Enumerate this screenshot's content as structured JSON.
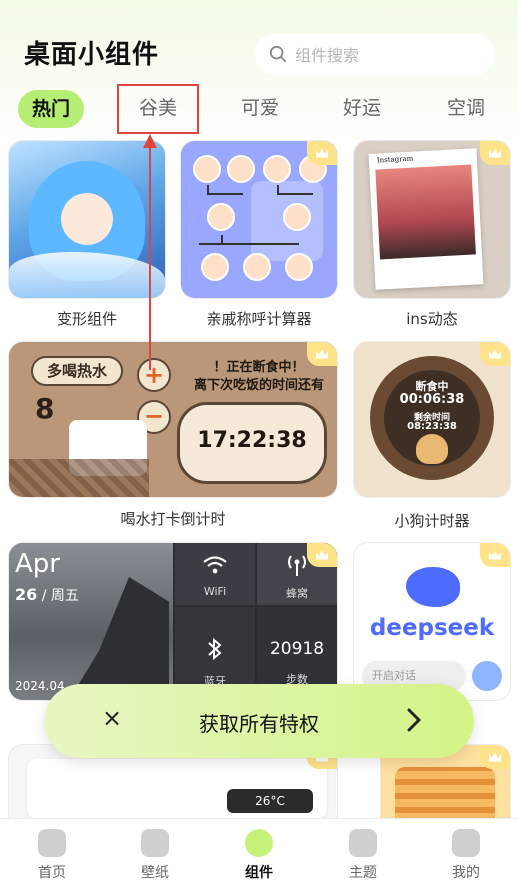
{
  "header": {
    "title": "桌面小组件"
  },
  "search": {
    "placeholder": "组件搜索"
  },
  "tabs": [
    {
      "label": "热门",
      "active": true
    },
    {
      "label": "谷美",
      "active": false
    },
    {
      "label": "可爱",
      "active": false
    },
    {
      "label": "好运",
      "active": false
    },
    {
      "label": "空调",
      "active": false
    }
  ],
  "cards": {
    "transform": {
      "label": "变形组件",
      "premium": false
    },
    "relatives": {
      "label": "亲戚称呼计算器",
      "premium": true
    },
    "ins": {
      "label": "ins动态",
      "premium": true,
      "brand": "Instagram"
    },
    "water": {
      "label": "喝水打卡倒计时",
      "premium": true,
      "badge": "多喝热水",
      "count": "8",
      "plus": "+",
      "minus": "−",
      "line1": "！正在断食中！",
      "line2": "离下次吃饭的时间还有",
      "time": "17:22:38"
    },
    "dog": {
      "label": "小狗计时器",
      "premium": true,
      "status": "断食中",
      "time1": "00:06:38",
      "remain_label": "剩余时间",
      "time2": "08:23:38"
    },
    "phone": {
      "month": "Apr",
      "day": "26",
      "weekday": "/ 周五",
      "year": "2024.04",
      "wifi": "WiFi",
      "cellular": "蜂窝",
      "bluetooth": "蓝牙",
      "steps": "20918",
      "steps_label": "步数"
    },
    "deepseek": {
      "brand": "deepseek",
      "input_placeholder": "开启对话",
      "premium": true
    },
    "ac": {
      "temp": "26°C"
    }
  },
  "promo": {
    "text": "获取所有特权",
    "close": "×"
  },
  "nav": [
    {
      "label": "首页",
      "icon": "home-icon",
      "active": false
    },
    {
      "label": "壁纸",
      "icon": "wallpaper-icon",
      "active": false
    },
    {
      "label": "组件",
      "icon": "widget-icon",
      "active": true
    },
    {
      "label": "主题",
      "icon": "theme-icon",
      "active": false
    },
    {
      "label": "我的",
      "icon": "profile-icon",
      "active": false
    }
  ],
  "colors": {
    "accent": "#b6ee74",
    "annotation": "#e0443e",
    "deepseek": "#4d6bfe"
  }
}
